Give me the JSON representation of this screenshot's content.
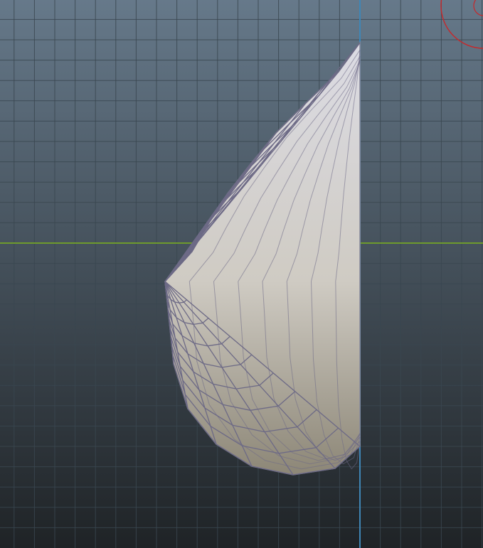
{
  "viewport": {
    "background_top": "#66798a",
    "background_bottom": "#1f2326",
    "grid_color": "#3a4650",
    "grid_opacity": 0.85
  },
  "axes": {
    "x_axis_color": "#6e9a2c",
    "y_axis_color": "#3f86b6"
  },
  "gizmo": {
    "icon": "rotation-gizmo-icon",
    "color": "#c8272a"
  },
  "mesh": {
    "icon": "mesh-object-icon",
    "object_type": "subdivided half-dome surface",
    "fill_top": "#dcdce4",
    "fill_bottom": "#8c8676",
    "wire_color": "#6d6a86",
    "silhouette_color": "#8a8898",
    "radial_segments": 9,
    "meridians": 8
  }
}
